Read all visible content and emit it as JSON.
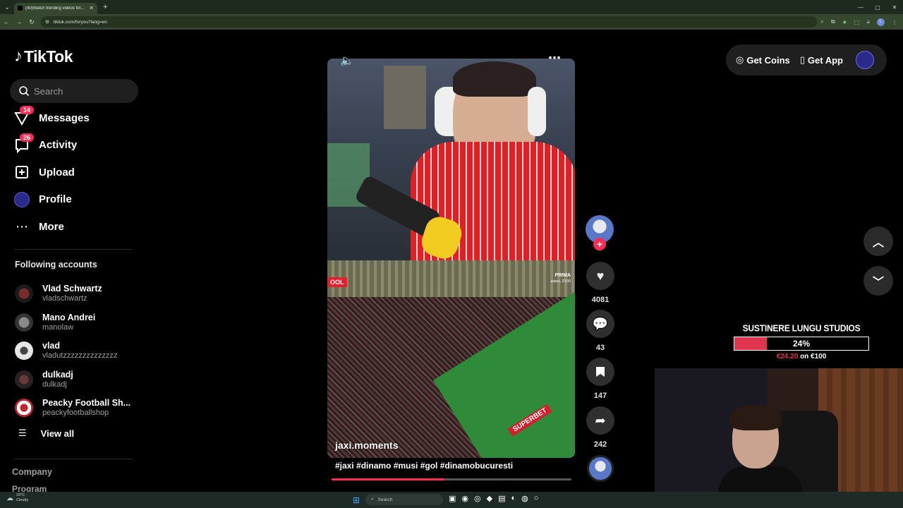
{
  "browser": {
    "tab_title": "(40)Watch trending videos for...",
    "url": "tiktok.com/foryou?lang=en"
  },
  "sidebar": {
    "brand": "TikTok",
    "search_placeholder": "Search",
    "nav": [
      {
        "label": "Messages",
        "badge": "14",
        "icon": "send-icon"
      },
      {
        "label": "Activity",
        "badge": "26",
        "icon": "activity-icon"
      },
      {
        "label": "Upload",
        "icon": "plus-square-icon"
      },
      {
        "label": "Profile",
        "icon": "avatar"
      },
      {
        "label": "More",
        "icon": "more-dots-icon"
      }
    ],
    "following_title": "Following accounts",
    "following": [
      {
        "name": "Vlad Schwartz",
        "username": "vladschwartz"
      },
      {
        "name": "Mano Andrei",
        "username": "manolaw"
      },
      {
        "name": "vlad",
        "username": "vladutzzzzzzzzzzzzzz"
      },
      {
        "name": "dulkadj",
        "username": "dulkadj"
      },
      {
        "name": "Peacky Football Sh...",
        "username": "peackyfootballshop"
      }
    ],
    "view_all": "View all",
    "footer": [
      "Company",
      "Program"
    ]
  },
  "video": {
    "overlay_tag": "OOL",
    "channel_text": "PRIMA",
    "channel_subtext": "astazi, 23:00",
    "board_text": "SUPERBET",
    "author": "jaxi.moments",
    "hashtags": "#jaxi #dinamo #musi #gol #dinamobucuresti",
    "progress": 0.47
  },
  "actions": {
    "likes": "4081",
    "comments": "43",
    "saves": "147",
    "shares": "242"
  },
  "topbar": {
    "get_coins": "Get Coins",
    "get_app": "Get App"
  },
  "donation": {
    "title": "SUSTINERE LUNGU STUDIOS",
    "percent_label": "24%",
    "percent": 0.24,
    "raised": "€24.20",
    "goal_text": "on €100"
  },
  "taskbar": {
    "temp": "10°C",
    "condition": "Cloudy",
    "search": "Search"
  }
}
